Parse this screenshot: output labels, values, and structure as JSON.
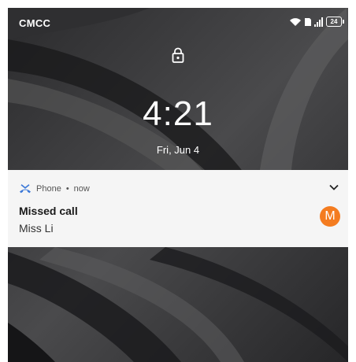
{
  "status_bar": {
    "carrier": "CMCC",
    "battery_level": "24",
    "icons": [
      "wifi-icon",
      "sim-icon",
      "signal-icon",
      "battery-icon"
    ]
  },
  "lock_screen": {
    "lock_icon": "lock-icon",
    "time": "4:21",
    "date": "Fri, Jun 4"
  },
  "notification": {
    "app_icon": "missed-call-icon",
    "app_name": "Phone",
    "separator": "•",
    "timestamp": "now",
    "title": "Missed call",
    "body": "Miss Li",
    "avatar_initial": "M",
    "avatar_color": "#f47c20",
    "accent_color": "#3b78d8"
  }
}
